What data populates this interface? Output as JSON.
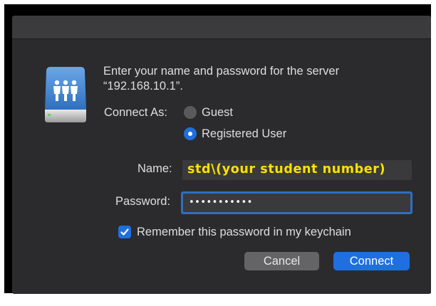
{
  "message": {
    "line1": "Enter your name and password for the server",
    "line2": "“192.168.10.1”."
  },
  "connect_as": {
    "label": "Connect As:",
    "options": [
      {
        "label": "Guest",
        "selected": false
      },
      {
        "label": "Registered User",
        "selected": true
      }
    ]
  },
  "form": {
    "name_label": "Name:",
    "name_value": "std\\(your student number)",
    "password_label": "Password:",
    "password_value": "•••••••••••"
  },
  "remember": {
    "label": "Remember this password in my keychain",
    "checked": true
  },
  "buttons": {
    "cancel": "Cancel",
    "connect": "Connect"
  },
  "icons": {
    "server": "server-users-icon",
    "checkmark": "checkmark-icon"
  },
  "colors": {
    "accent": "#1f6fe0",
    "name_text": "#ffe100",
    "dialog_bg": "#2b2b2d"
  }
}
